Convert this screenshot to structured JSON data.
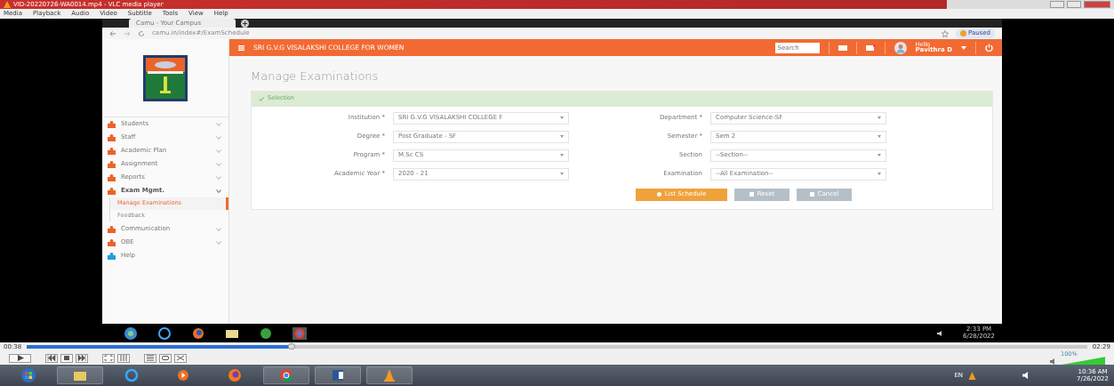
{
  "window": {
    "title": "VID-20220726-WA0014.mp4 - VLC media player"
  },
  "menu": [
    "Media",
    "Playback",
    "Audio",
    "Video",
    "Subtitle",
    "Tools",
    "View",
    "Help"
  ],
  "browser": {
    "tab": "Camu - Your Campus",
    "url": "camu.in/index#/ExamSchedule",
    "profile": "Paused"
  },
  "app": {
    "brand": "SRI G.V.G VISALAKSHI COLLEGE FOR WOMEN",
    "search": {
      "placeholder": "Search"
    },
    "user": {
      "greeting": "Hello",
      "name": "Pavithra D"
    }
  },
  "sidebar": {
    "items": [
      {
        "label": "Students",
        "expanded": false
      },
      {
        "label": "Staff",
        "expanded": false
      },
      {
        "label": "Academic Plan",
        "expanded": false
      },
      {
        "label": "Assignment",
        "expanded": false
      },
      {
        "label": "Reports",
        "expanded": false
      },
      {
        "label": "Exam Mgmt.",
        "expanded": true,
        "children": [
          {
            "label": "Manage Examinations",
            "selected": true
          },
          {
            "label": "Feedback",
            "selected": false
          }
        ]
      },
      {
        "label": "Communication",
        "expanded": false
      },
      {
        "label": "OBE",
        "expanded": false
      },
      {
        "label": "Help"
      }
    ]
  },
  "page_title": "Manage Examinations",
  "panel": {
    "title": "Selection",
    "left_fields": [
      {
        "label": "Institution *",
        "value": "SRI G.V.G VISALAKSHI COLLEGE F"
      },
      {
        "label": "Degree *",
        "value": "Post Graduate - SF"
      },
      {
        "label": "Program *",
        "value": "M.Sc CS"
      },
      {
        "label": "Academic Year *",
        "value": "2020 - 21"
      }
    ],
    "right_fields": [
      {
        "label": "Department *",
        "value": "Computer Science-SF"
      },
      {
        "label": "Semester *",
        "value": "Sem 2"
      },
      {
        "label": "Section",
        "value": "--Section--"
      },
      {
        "label": "Examination",
        "value": "--All Examination--"
      }
    ],
    "buttons": [
      {
        "label": "List Schedule",
        "kind": "primary"
      },
      {
        "label": "Reset",
        "kind": "secondary"
      },
      {
        "label": "Cancel",
        "kind": "secondary"
      }
    ]
  },
  "inner_taskbar": {
    "time": "2:33 PM",
    "date": "6/28/2022"
  },
  "player": {
    "elapsed": "00:38",
    "total": "02:29",
    "level": 0.25,
    "volume": {
      "level": 1.0,
      "reading": "100%"
    }
  },
  "taskbar": {
    "language": "EN",
    "time": "10:36 AM",
    "date": "7/26/2022"
  }
}
